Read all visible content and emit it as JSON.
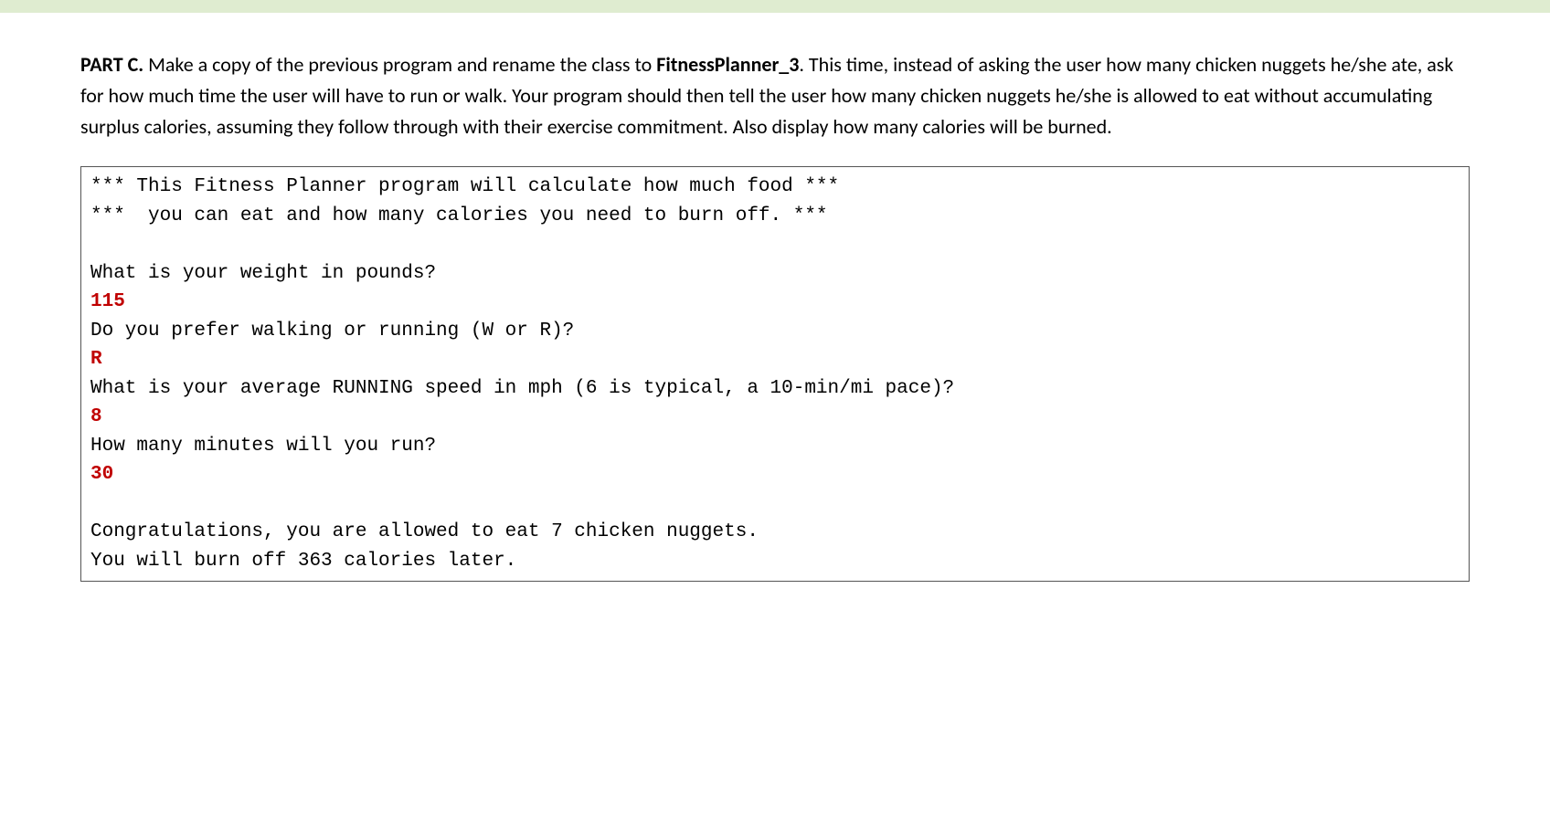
{
  "paragraph": {
    "part_label": "PART C.",
    "text1": " Make a copy of the previous program and rename the class to ",
    "class_name": "FitnessPlanner_3",
    "text2": ". This time, instead of asking the user how many chicken nuggets he/she ate, ask for how much time the user will have to run or walk. Your program should then tell the user how many chicken nuggets he/she is allowed to eat without accumulating surplus calories, assuming they follow through with their exercise commitment. Also display how many calories will be burned."
  },
  "code": {
    "line1": "*** This Fitness Planner program will calculate how much food ***",
    "line2": "***  you can eat and how many calories you need to burn off. ***",
    "line3": "",
    "line4": "What is your weight in pounds?",
    "line5": "115",
    "line6": "Do you prefer walking or running (W or R)?",
    "line7": "R",
    "line8": "What is your average RUNNING speed in mph (6 is typical, a 10-min/mi pace)?",
    "line9": "8",
    "line10": "How many minutes will you run?",
    "line11": "30",
    "line12": "",
    "line13": "Congratulations, you are allowed to eat 7 chicken nuggets.",
    "line14": "You will burn off 363 calories later."
  }
}
